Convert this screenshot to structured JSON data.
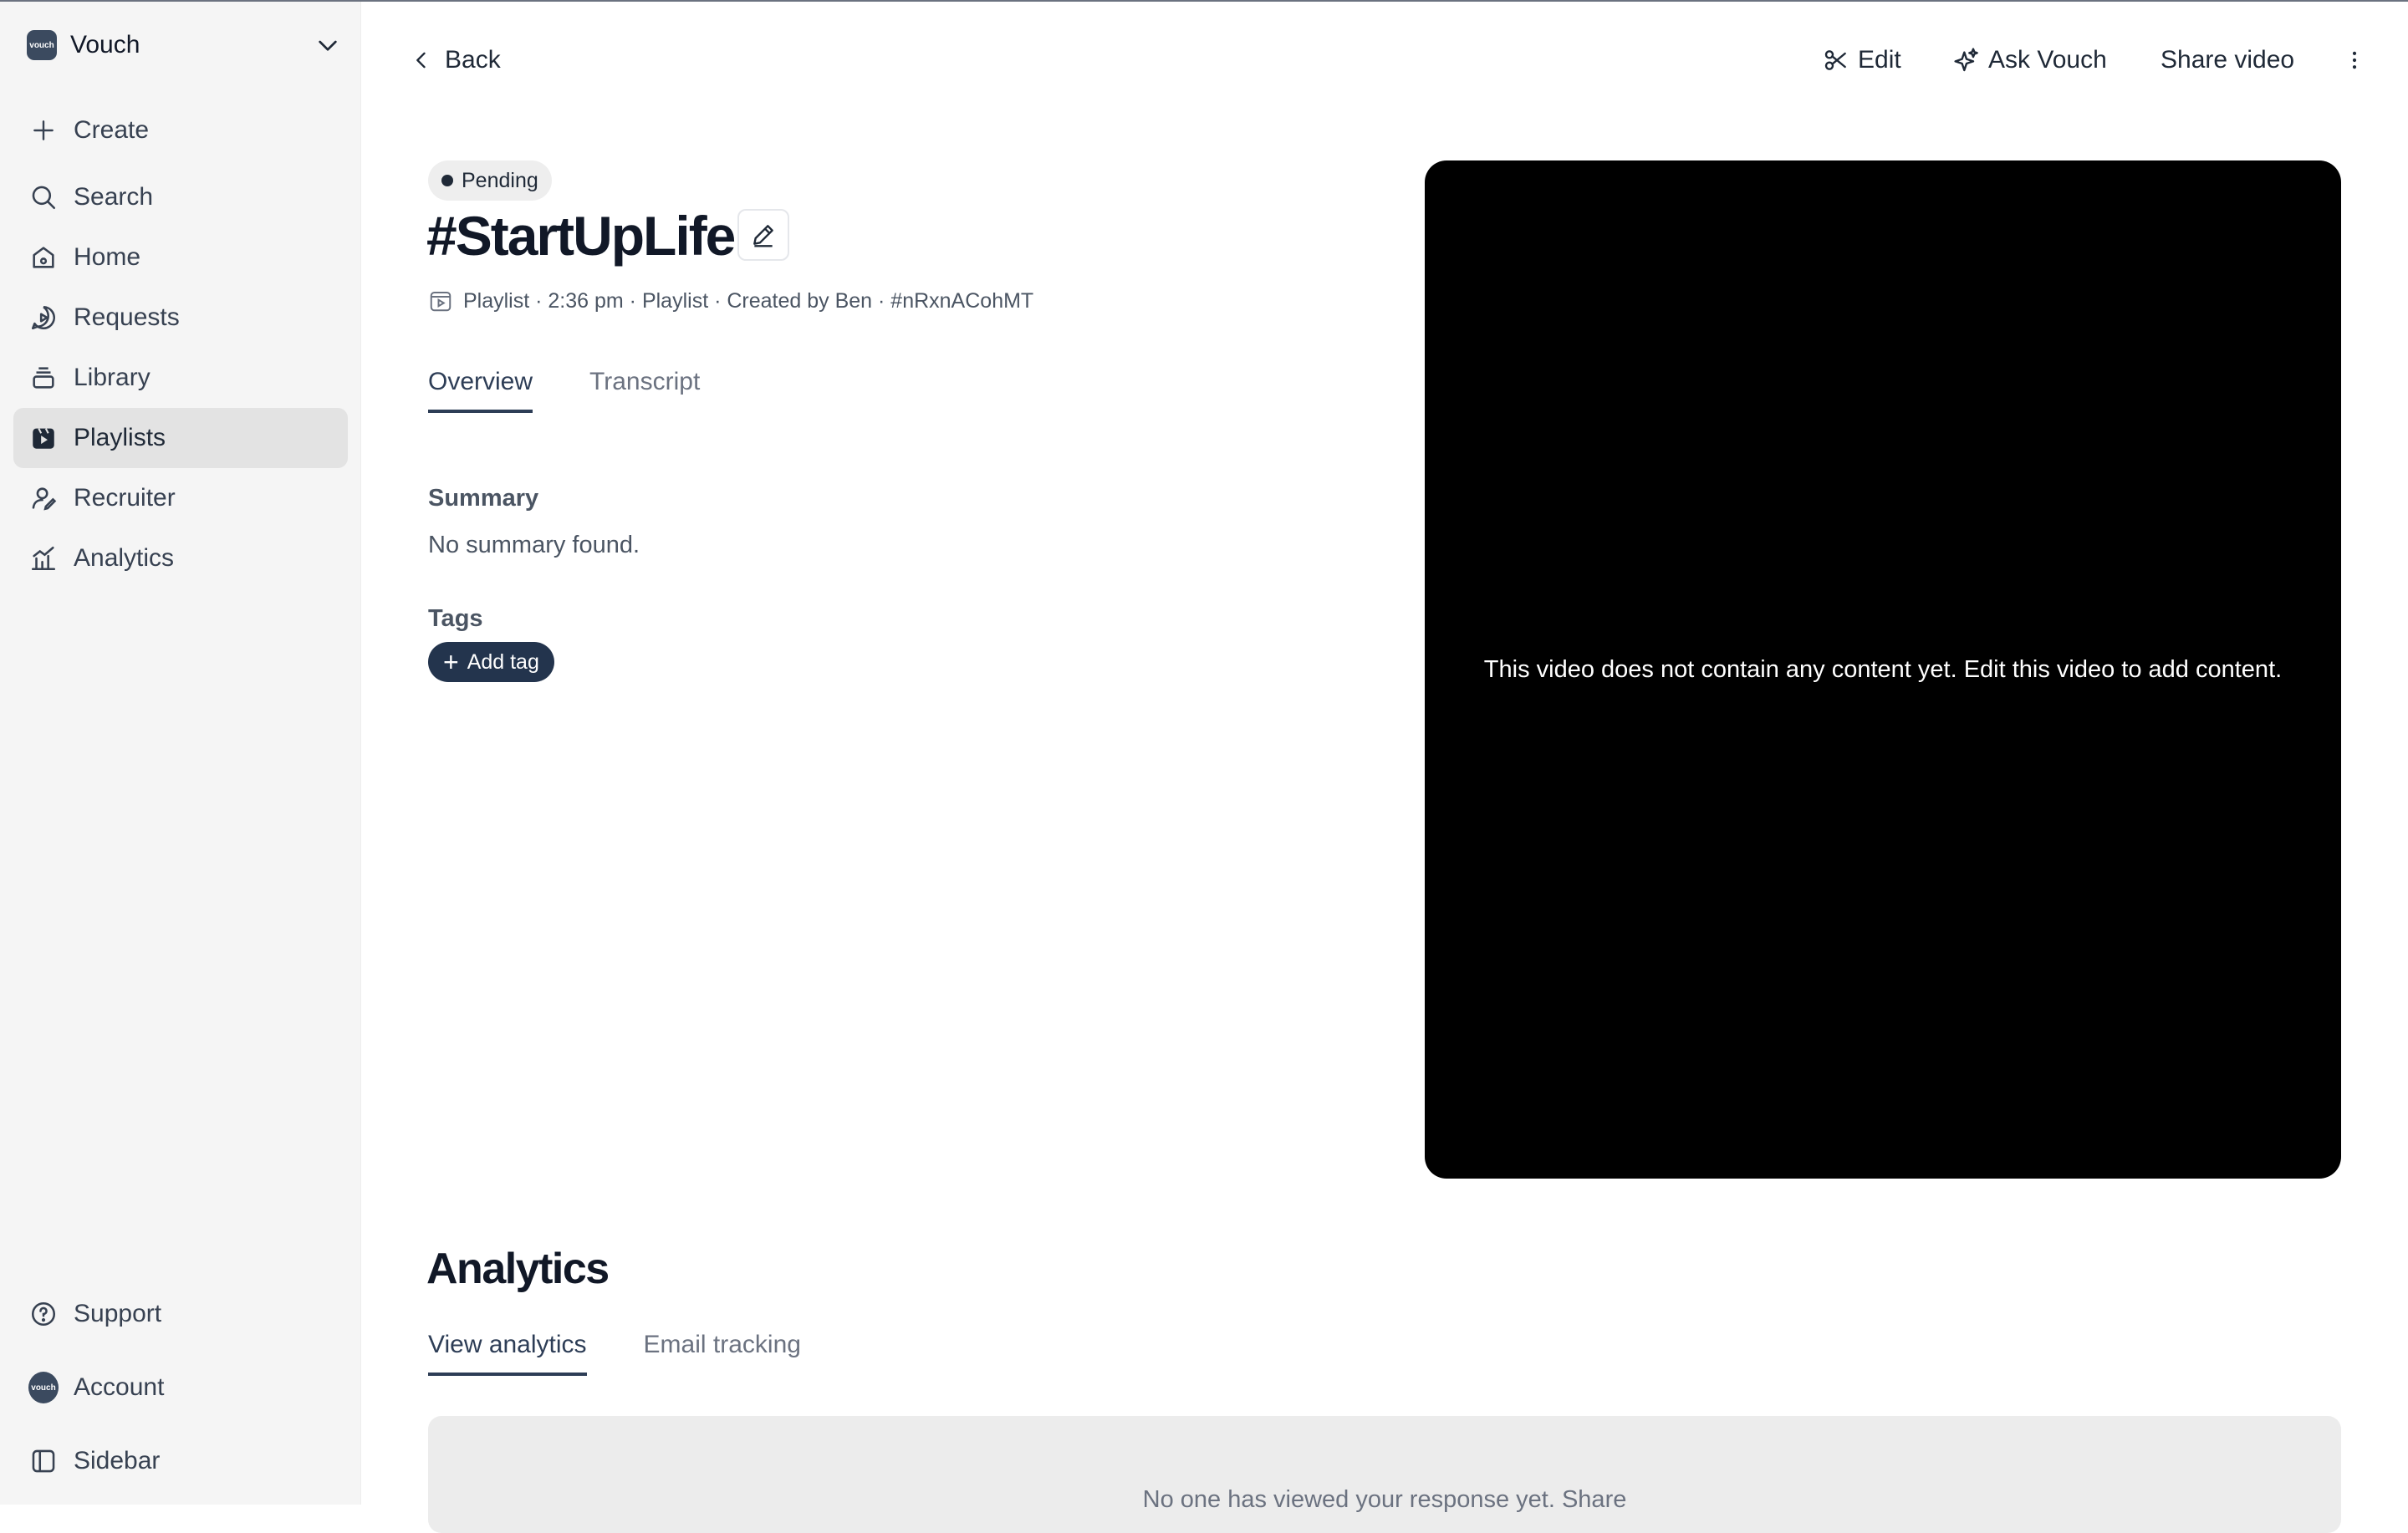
{
  "workspace": {
    "logo_text": "vouch",
    "name": "Vouch"
  },
  "sidebar": {
    "items": [
      {
        "label": "Create",
        "icon": "plus-icon"
      },
      {
        "label": "Search",
        "icon": "search-icon"
      },
      {
        "label": "Home",
        "icon": "home-icon"
      },
      {
        "label": "Requests",
        "icon": "requests-icon"
      },
      {
        "label": "Library",
        "icon": "library-icon"
      },
      {
        "label": "Playlists",
        "icon": "playlists-icon",
        "active": true
      },
      {
        "label": "Recruiter",
        "icon": "recruiter-icon"
      },
      {
        "label": "Analytics",
        "icon": "analytics-icon"
      }
    ],
    "footer": [
      {
        "label": "Support",
        "icon": "help-icon"
      },
      {
        "label": "Account",
        "icon": "avatar"
      },
      {
        "label": "Sidebar",
        "icon": "sidebar-toggle-icon"
      }
    ]
  },
  "header": {
    "back_label": "Back",
    "edit_label": "Edit",
    "ask_label": "Ask Vouch",
    "share_label": "Share video"
  },
  "video_info": {
    "status": "Pending",
    "title": "#StartUpLife",
    "meta": "Playlist · 2:36 pm · Playlist · Created by Ben · #nRxnACohMT"
  },
  "tabs": {
    "overview": "Overview",
    "transcript": "Transcript"
  },
  "summary": {
    "heading": "Summary",
    "text": "No summary found."
  },
  "tags": {
    "heading": "Tags",
    "add_label": "Add tag"
  },
  "player": {
    "message": "This video does not contain any content yet. Edit this video to add content."
  },
  "analytics": {
    "title": "Analytics",
    "tab_views": "View analytics",
    "tab_email": "Email tracking",
    "empty_text": "No one has viewed your response yet. Share"
  },
  "colors": {
    "primary": "#23344d",
    "sidebar_bg": "#f5f5f5",
    "active_item_bg": "#e3e3e3"
  }
}
